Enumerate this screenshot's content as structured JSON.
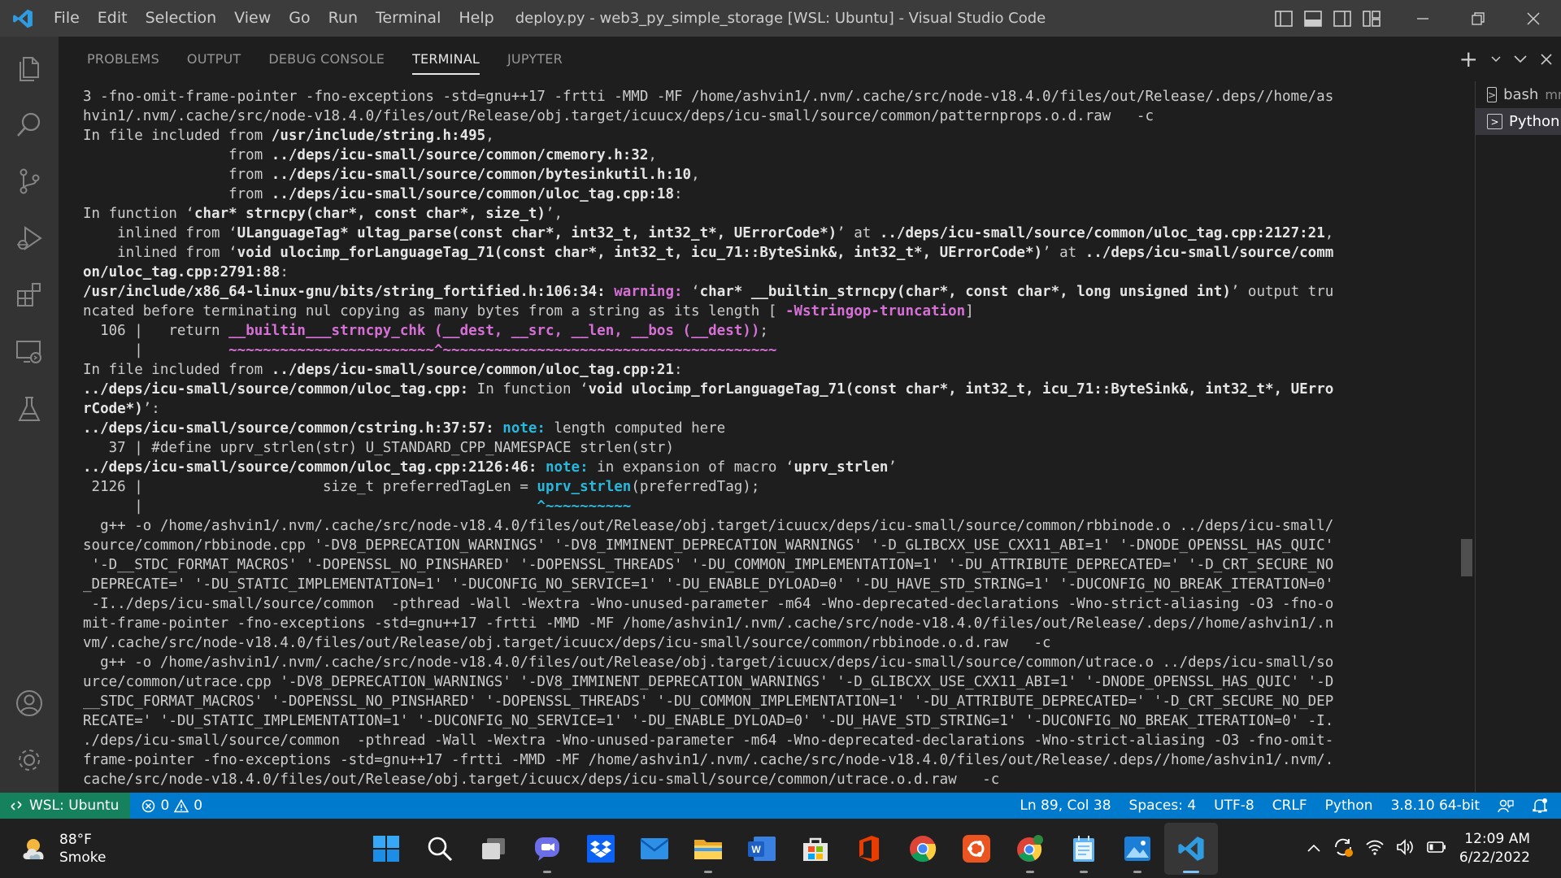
{
  "window": {
    "title": "deploy.py - web3_py_simple_storage [WSL: Ubuntu] - Visual Studio Code"
  },
  "menu": [
    "File",
    "Edit",
    "Selection",
    "View",
    "Go",
    "Run",
    "Terminal",
    "Help"
  ],
  "panel": {
    "tabs": [
      "PROBLEMS",
      "OUTPUT",
      "DEBUG CONSOLE",
      "TERMINAL",
      "JUPYTER"
    ],
    "active_tab": "TERMINAL",
    "add_symbol": "+",
    "terminals": [
      {
        "name": "bash",
        "detail": "mnt"
      },
      {
        "name": "Python",
        "detail": ""
      }
    ]
  },
  "terminal_lines": [
    [
      [
        "",
        "3 -fno-omit-frame-pointer -fno-exceptions -std=gnu++17 -frtti -MMD -MF /home/ashvin1/.nvm/.cache/src/node-v18.4.0/files/out/Release/.deps//home/as"
      ]
    ],
    [
      [
        "",
        "hvin1/.nvm/.cache/src/node-v18.4.0/files/out/Release/obj.target/icuucx/deps/icu-small/source/common/patternprops.o.d.raw   -c"
      ]
    ],
    [
      [
        "",
        "In file included from "
      ],
      [
        "c-white",
        "/usr/include/string.h:495"
      ],
      [
        "",
        ","
      ]
    ],
    [
      [
        "",
        "                 from "
      ],
      [
        "c-white",
        "../deps/icu-small/source/common/cmemory.h:32"
      ],
      [
        "",
        ","
      ]
    ],
    [
      [
        "",
        "                 from "
      ],
      [
        "c-white",
        "../deps/icu-small/source/common/bytesinkutil.h:10"
      ],
      [
        "",
        ","
      ]
    ],
    [
      [
        "",
        "                 from "
      ],
      [
        "c-white",
        "../deps/icu-small/source/common/uloc_tag.cpp:18"
      ],
      [
        "",
        ":"
      ]
    ],
    [
      [
        "",
        "In function ‘"
      ],
      [
        "c-white",
        "char* strncpy(char*, const char*, size_t)"
      ],
      [
        "",
        "’,"
      ]
    ],
    [
      [
        "",
        "    inlined from ‘"
      ],
      [
        "c-white",
        "ULanguageTag* ultag_parse(const char*, int32_t, int32_t*, UErrorCode*)"
      ],
      [
        "",
        "’ at "
      ],
      [
        "c-white",
        "../deps/icu-small/source/common/uloc_tag.cpp:2127:21"
      ],
      [
        "",
        ","
      ]
    ],
    [
      [
        "",
        "    inlined from ‘"
      ],
      [
        "c-white",
        "void ulocimp_forLanguageTag_71(const char*, int32_t, icu_71::ByteSink&, int32_t*, UErrorCode*)"
      ],
      [
        "",
        "’ at "
      ],
      [
        "c-white",
        "../deps/icu-small/source/comm"
      ]
    ],
    [
      [
        "c-white",
        "on/uloc_tag.cpp:2791:88"
      ],
      [
        "",
        ":"
      ]
    ],
    [
      [
        "c-white",
        "/usr/include/x86_64-linux-gnu/bits/string_fortified.h:106:34:"
      ],
      [
        "",
        " "
      ],
      [
        "c-magenta",
        "warning: "
      ],
      [
        "",
        "‘"
      ],
      [
        "c-white",
        "char* __builtin_strncpy(char*, const char*, long unsigned int)"
      ],
      [
        "",
        "’ output tru"
      ]
    ],
    [
      [
        "",
        "ncated before terminating nul copying as many bytes from a string as its length [ "
      ],
      [
        "c-magenta",
        "-Wstringop-truncation"
      ],
      [
        "",
        "]"
      ]
    ],
    [
      [
        "",
        "  106 |   return "
      ],
      [
        "c-magenta",
        "__builtin___strncpy_chk (__dest, __src, __len, __bos (__dest))"
      ],
      [
        "",
        ";"
      ]
    ],
    [
      [
        "",
        "      |          "
      ],
      [
        "c-magenta",
        "~~~~~~~~~~~~~~~~~~~~~~~~^~~~~~~~~~~~~~~~~~~~~~~~~~~~~~~~~~~~~~~~"
      ]
    ],
    [
      [
        "",
        "In file included from "
      ],
      [
        "c-white",
        "../deps/icu-small/source/common/uloc_tag.cpp:21"
      ],
      [
        "",
        ":"
      ]
    ],
    [
      [
        "c-white",
        "../deps/icu-small/source/common/uloc_tag.cpp:"
      ],
      [
        "",
        " In function ‘"
      ],
      [
        "c-white",
        "void ulocimp_forLanguageTag_71(const char*, int32_t, icu_71::ByteSink&, int32_t*, UErro"
      ]
    ],
    [
      [
        "c-white",
        "rCode*)"
      ],
      [
        "",
        "’:"
      ]
    ],
    [
      [
        "c-white",
        "../deps/icu-small/source/common/cstring.h:37:57:"
      ],
      [
        "",
        " "
      ],
      [
        "c-cyan",
        "note: "
      ],
      [
        "",
        "length computed here"
      ]
    ],
    [
      [
        "",
        "   37 | #define uprv_strlen(str) U_STANDARD_CPP_NAMESPACE strlen(str)"
      ]
    ],
    [
      [
        "c-white",
        "../deps/icu-small/source/common/uloc_tag.cpp:2126:46:"
      ],
      [
        "",
        " "
      ],
      [
        "c-cyan",
        "note: "
      ],
      [
        "",
        "in expansion of macro ‘"
      ],
      [
        "c-white",
        "uprv_strlen"
      ],
      [
        "",
        "’"
      ]
    ],
    [
      [
        "",
        " 2126 |                     size_t preferredTagLen = "
      ],
      [
        "c-cyan",
        "uprv_strlen"
      ],
      [
        "",
        "(preferredTag);"
      ]
    ],
    [
      [
        "",
        "      |                                              "
      ],
      [
        "c-cyan",
        "^~~~~~~~~~~"
      ]
    ],
    [
      [
        "",
        "  g++ -o /home/ashvin1/.nvm/.cache/src/node-v18.4.0/files/out/Release/obj.target/icuucx/deps/icu-small/source/common/rbbinode.o ../deps/icu-small/"
      ]
    ],
    [
      [
        "",
        "source/common/rbbinode.cpp '-DV8_DEPRECATION_WARNINGS' '-DV8_IMMINENT_DEPRECATION_WARNINGS' '-D_GLIBCXX_USE_CXX11_ABI=1' '-DNODE_OPENSSL_HAS_QUIC'"
      ]
    ],
    [
      [
        "",
        " '-D__STDC_FORMAT_MACROS' '-DOPENSSL_NO_PINSHARED' '-DOPENSSL_THREADS' '-DU_COMMON_IMPLEMENTATION=1' '-DU_ATTRIBUTE_DEPRECATED=' '-D_CRT_SECURE_NO"
      ]
    ],
    [
      [
        "",
        "_DEPRECATE=' '-DU_STATIC_IMPLEMENTATION=1' '-DUCONFIG_NO_SERVICE=1' '-DU_ENABLE_DYLOAD=0' '-DU_HAVE_STD_STRING=1' '-DUCONFIG_NO_BREAK_ITERATION=0'"
      ]
    ],
    [
      [
        "",
        " -I../deps/icu-small/source/common  -pthread -Wall -Wextra -Wno-unused-parameter -m64 -Wno-deprecated-declarations -Wno-strict-aliasing -O3 -fno-o"
      ]
    ],
    [
      [
        "",
        "mit-frame-pointer -fno-exceptions -std=gnu++17 -frtti -MMD -MF /home/ashvin1/.nvm/.cache/src/node-v18.4.0/files/out/Release/.deps//home/ashvin1/.n"
      ]
    ],
    [
      [
        "",
        "vm/.cache/src/node-v18.4.0/files/out/Release/obj.target/icuucx/deps/icu-small/source/common/rbbinode.o.d.raw   -c"
      ]
    ],
    [
      [
        "",
        "  g++ -o /home/ashvin1/.nvm/.cache/src/node-v18.4.0/files/out/Release/obj.target/icuucx/deps/icu-small/source/common/utrace.o ../deps/icu-small/so"
      ]
    ],
    [
      [
        "",
        "urce/common/utrace.cpp '-DV8_DEPRECATION_WARNINGS' '-DV8_IMMINENT_DEPRECATION_WARNINGS' '-D_GLIBCXX_USE_CXX11_ABI=1' '-DNODE_OPENSSL_HAS_QUIC' '-D"
      ]
    ],
    [
      [
        "",
        "__STDC_FORMAT_MACROS' '-DOPENSSL_NO_PINSHARED' '-DOPENSSL_THREADS' '-DU_COMMON_IMPLEMENTATION=1' '-DU_ATTRIBUTE_DEPRECATED=' '-D_CRT_SECURE_NO_DEP"
      ]
    ],
    [
      [
        "",
        "RECATE=' '-DU_STATIC_IMPLEMENTATION=1' '-DUCONFIG_NO_SERVICE=1' '-DU_ENABLE_DYLOAD=0' '-DU_HAVE_STD_STRING=1' '-DUCONFIG_NO_BREAK_ITERATION=0' -I."
      ]
    ],
    [
      [
        "",
        "./deps/icu-small/source/common  -pthread -Wall -Wextra -Wno-unused-parameter -m64 -Wno-deprecated-declarations -Wno-strict-aliasing -O3 -fno-omit-"
      ]
    ],
    [
      [
        "",
        "frame-pointer -fno-exceptions -std=gnu++17 -frtti -MMD -MF /home/ashvin1/.nvm/.cache/src/node-v18.4.0/files/out/Release/.deps//home/ashvin1/.nvm/."
      ]
    ],
    [
      [
        "",
        "cache/src/node-v18.4.0/files/out/Release/obj.target/icuucx/deps/icu-small/source/common/utrace.o.d.raw   -c"
      ]
    ]
  ],
  "statusbar": {
    "remote": "WSL: Ubuntu",
    "errors": "0",
    "warnings": "0",
    "position": "Ln 89, Col 38",
    "spaces": "Spaces: 4",
    "encoding": "UTF-8",
    "eol": "CRLF",
    "language": "Python",
    "interpreter": "3.8.10 64-bit"
  },
  "taskbar": {
    "weather_temp": "88°F",
    "weather_desc": "Smoke",
    "time": "12:09 AM",
    "date": "6/22/2022",
    "apps": [
      "windows-start-icon",
      "search-icon",
      "task-view-icon",
      "teams-chat-icon",
      "dropbox-icon",
      "mail-icon",
      "file-explorer-icon",
      "word-icon",
      "microsoft-store-icon",
      "office-icon",
      "chrome-icon",
      "ubuntu-icon",
      "chrome-profile-icon",
      "notepad-icon",
      "photos-icon",
      "vscode-icon"
    ]
  },
  "colors": {
    "titlebar": "#3c3c3c",
    "activitybar": "#333333",
    "panel": "#1e1e1e",
    "statusbar": "#007acc",
    "remote": "#16825d",
    "taskbar": "#202020",
    "warning": "#d670d6",
    "note": "#29b8db"
  }
}
